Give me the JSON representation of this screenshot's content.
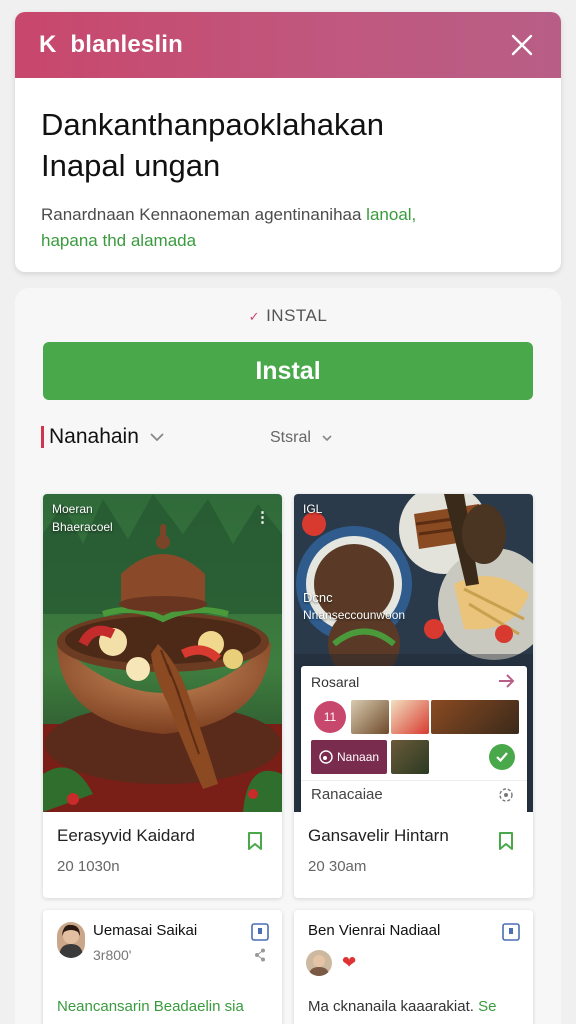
{
  "banner": {
    "brand_letter": "K",
    "brand_name": "blanleslin",
    "headline_line1": "Dankanthanpaoklahakan",
    "headline_line2": "Inapal ungan",
    "desc_line1": "Ranardnaan  Kennaoneman agentinanihaa",
    "desc_line1_accent": "lanoal,",
    "desc_line2": "hapana",
    "desc_line2_accent": "thd",
    "desc_line2_end": "alamada"
  },
  "install": {
    "caption": "INSTAL",
    "button_label": "Instal"
  },
  "filters": {
    "left_label": "Nanahain",
    "right_label": "Stsral"
  },
  "cards": [
    {
      "overlay_line1": "Moeran",
      "overlay_line2": "Bhaeracoel",
      "menu_dots": "⋮",
      "title": "Eerasyvid Kaidard",
      "time": "20 1030n"
    },
    {
      "overlay_tag": "IGL",
      "overlay_line1": "Dcnc",
      "overlay_line2": "Nnanseccounwoon",
      "title": "Gansavelir Hintarn",
      "time": "20 30am",
      "popover": {
        "head": "Rosaral",
        "tag_label": "Nanaan",
        "tag_num": "11",
        "foot": "Ranacaiae"
      }
    }
  ],
  "people": [
    {
      "name": "Uemasai Saikai",
      "meta": "3r800'",
      "snippet": "Neancansarin",
      "snippet_accent": "Beadaelin sia"
    },
    {
      "name": "Ben Vienrai Nadiaal",
      "snippet": "Ma cknanaila kaaarakiat.",
      "snippet_accent": "Se"
    }
  ],
  "colors": {
    "banner_start": "#c8476c",
    "banner_end": "#b85e86",
    "install_green": "#49a84a",
    "accent_green": "#3a9b3e",
    "pink_mark": "#d0344f",
    "tag_plum": "#7a2c4f"
  }
}
